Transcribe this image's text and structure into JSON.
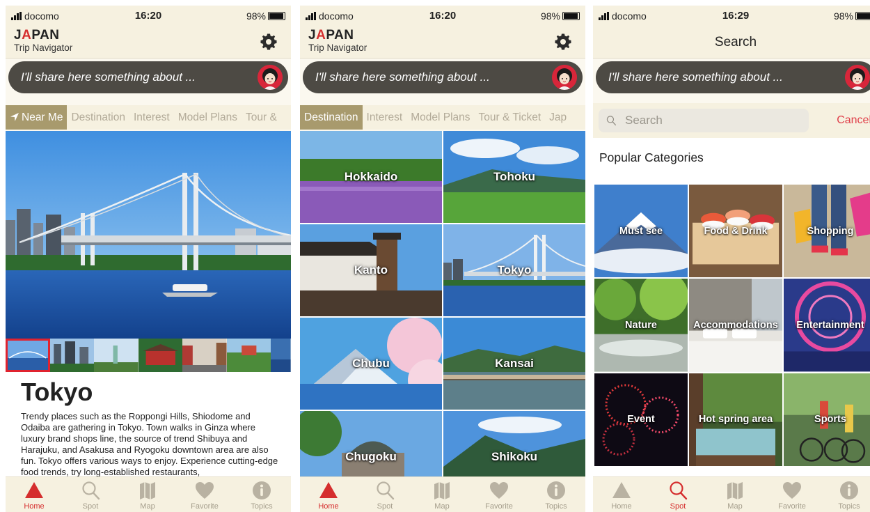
{
  "screens": [
    {
      "status": {
        "carrier": "docomo",
        "time": "16:20",
        "battery": "98%"
      },
      "header": {
        "logo": "JAPAN",
        "subtitle": "Trip Navigator"
      },
      "banner": {
        "text": "I'll share here something about ..."
      },
      "tabs": [
        "Near Me",
        "Destination",
        "Interest",
        "Model Plans",
        "Tour &"
      ],
      "city": {
        "name": "Tokyo",
        "description": "Trendy places such as the Roppongi Hills, Shiodome and Odaiba are gathering in Tokyo. Town walks in Ginza where luxury brand shops line, the source of trend Shibuya and Harajuku, and Asakusa and Ryogoku downtown area are also fun. Tokyo offers various ways to enjoy. Experience cutting-edge food trends, try long-established restaurants,"
      },
      "tabbar": [
        "Home",
        "Spot",
        "Map",
        "Favorite",
        "Topics"
      ],
      "tabbar_active": 0
    },
    {
      "status": {
        "carrier": "docomo",
        "time": "16:20",
        "battery": "98%"
      },
      "header": {
        "logo": "JAPAN",
        "subtitle": "Trip Navigator"
      },
      "banner": {
        "text": "I'll share here something about ..."
      },
      "tabs": [
        "Destination",
        "Interest",
        "Model Plans",
        "Tour & Ticket",
        "Jap"
      ],
      "regions": [
        "Hokkaido",
        "Tohoku",
        "Kanto",
        "Tokyo",
        "Chubu",
        "Kansai",
        "Chugoku",
        "Shikoku"
      ],
      "tabbar": [
        "Home",
        "Spot",
        "Map",
        "Favorite",
        "Topics"
      ],
      "tabbar_active": 0
    },
    {
      "status": {
        "carrier": "docomo",
        "time": "16:29",
        "battery": "98%"
      },
      "header": {
        "title": "Search"
      },
      "banner": {
        "text": "I'll share here something about ..."
      },
      "search": {
        "placeholder": "Search",
        "cancel": "Cancel"
      },
      "popular_title": "Popular Categories",
      "categories": [
        "Must see",
        "Food & Drink",
        "Shopping",
        "Nature",
        "Accommodations",
        "Entertainment",
        "Event",
        "Hot spring area",
        "Sports"
      ],
      "tabbar": [
        "Home",
        "Spot",
        "Map",
        "Favorite",
        "Topics"
      ],
      "tabbar_active": 1
    }
  ],
  "colors": {
    "accent": "#d52e2e",
    "tab_active": "#a89a6d",
    "banner": "#4d4a44",
    "header_bg": "#f6f1e0"
  }
}
